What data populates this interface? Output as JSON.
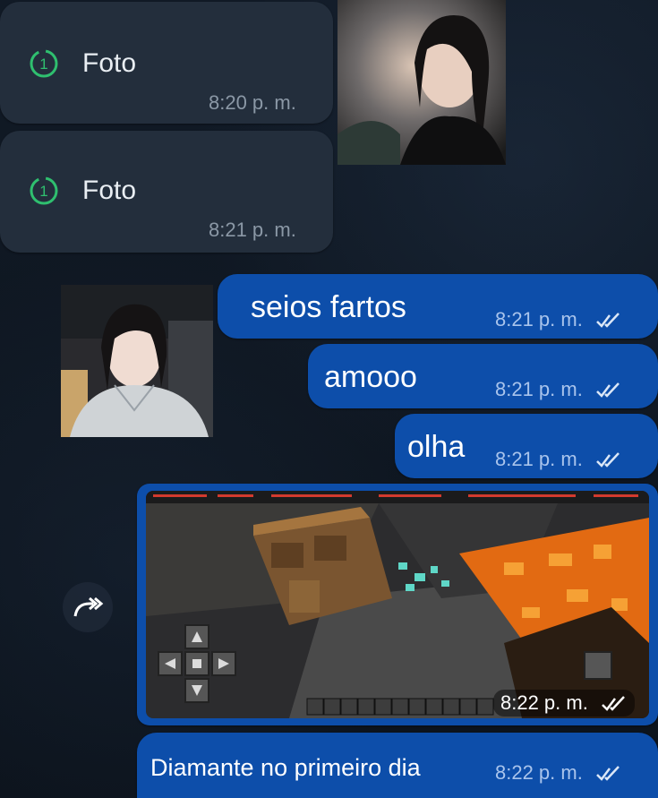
{
  "incoming": [
    {
      "label": "Foto",
      "time": "8:20 p. m.",
      "icon": "view-once-icon"
    },
    {
      "label": "Foto",
      "time": "8:21 p. m.",
      "icon": "view-once-icon"
    }
  ],
  "outgoing": [
    {
      "text": "seios fartos",
      "time": "8:21 p. m."
    },
    {
      "text": "amooo",
      "time": "8:21 p. m."
    },
    {
      "text": "olha",
      "time": "8:21 p. m."
    }
  ],
  "media_message": {
    "time": "8:22 p. m.",
    "icon": "forward-icon"
  },
  "last_message": {
    "text": "Diamante no primeiro dia",
    "time": "8:22 p. m."
  },
  "colors": {
    "outgoing_bubble": "#0d4eaa",
    "incoming_bubble": "#232e3c",
    "view_once_accent": "#2fbf6f"
  }
}
